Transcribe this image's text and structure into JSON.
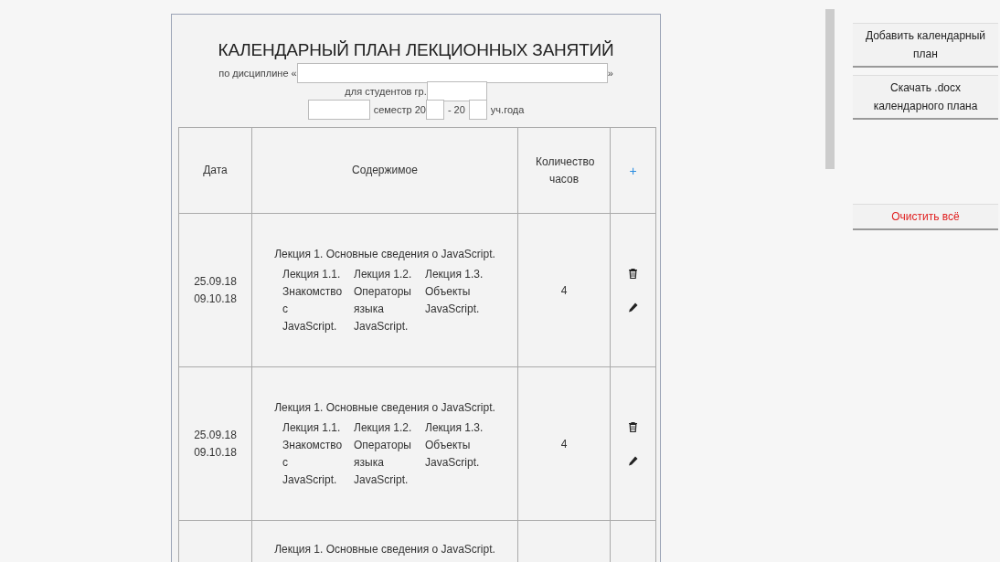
{
  "title": "КАЛЕНДАРНЫЙ ПЛАН ЛЕКЦИОННЫХ ЗАНЯТИЙ",
  "form": {
    "discipline_label": "по дисциплине «",
    "discipline_close": "»",
    "group_label": "для студентов гр.",
    "semester_label": "семестр 20",
    "year_separator": "- 20",
    "year_suffix": "уч.года"
  },
  "table": {
    "columns": [
      {
        "label": "Дата",
        "kind": "text"
      },
      {
        "label": "Содержимое",
        "kind": "text"
      },
      {
        "label": "Количество часов",
        "kind": "text"
      },
      {
        "label": "+",
        "kind": "add"
      }
    ],
    "rows": [
      {
        "dates": [
          "25.09.18",
          "09.10.18"
        ],
        "lecture": "Лекция 1. Основные сведения о JavaScript.",
        "sublectures": [
          "Лекция 1.1. Знакомство с JavaScript.",
          "Лекция 1.2. Операторы языка JavaScript.",
          "Лекция 1.3. Объекты JavaScript."
        ],
        "hours": "4"
      },
      {
        "dates": [
          "25.09.18",
          "09.10.18"
        ],
        "lecture": "Лекция 1. Основные сведения о JavaScript.",
        "sublectures": [
          "Лекция 1.1. Знакомство с JavaScript.",
          "Лекция 1.2. Операторы языка JavaScript.",
          "Лекция 1.3. Объекты JavaScript."
        ],
        "hours": "4"
      },
      {
        "lecture": "Лекция 1. Основные сведения о JavaScript."
      }
    ]
  },
  "actions": [
    {
      "label": "Добавить календарный план",
      "kind": "normal"
    },
    {
      "label": "Скачать .docx календарного плана",
      "kind": "normal"
    },
    {
      "label": "Очистить всё",
      "kind": "danger"
    }
  ]
}
